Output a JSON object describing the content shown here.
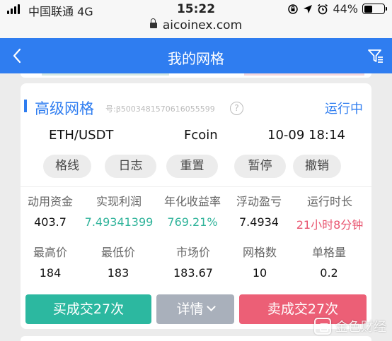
{
  "status_bar": {
    "carrier": "中国联通  4G",
    "time": "15:22",
    "battery": "44%",
    "battery_level": 0.44
  },
  "browser": {
    "url": "aicoinex.com"
  },
  "nav": {
    "title": "我的网格"
  },
  "card": {
    "title": "高级网格",
    "id": "号:β5003481570616055599",
    "help": "?",
    "status": "运行中",
    "pair": "ETH/USDT",
    "exchange": "Fcoin",
    "datetime": "10-09 18:14",
    "actions": [
      "格线",
      "日志",
      "重置",
      "暂停",
      "撤销"
    ],
    "stats_row1": [
      {
        "label": "动用资金",
        "value": "403.7"
      },
      {
        "label": "实现利润",
        "value": "7.49341399"
      },
      {
        "label": "年化收益率",
        "value": "769.21%"
      },
      {
        "label": "浮动盈亏",
        "value": "7.4934"
      },
      {
        "label": "运行时长",
        "value": "21小时8分钟"
      }
    ],
    "stats_row2": [
      {
        "label": "最高价",
        "value": "184"
      },
      {
        "label": "最低价",
        "value": "183"
      },
      {
        "label": "市场价",
        "value": "183.67"
      },
      {
        "label": "网格数",
        "value": "10"
      },
      {
        "label": "单格量",
        "value": "0.2"
      }
    ],
    "buy_button": "买成交27次",
    "detail_button": "详情",
    "sell_button": "卖成交27次"
  },
  "watermark": "金色财经",
  "colors": {
    "accent": "#2f7df0",
    "profit": "#2fb39a",
    "runtime": "#e8546f",
    "buy": "#2cb8a0",
    "sell": "#ec5f76",
    "detail": "#a9b0bb"
  }
}
